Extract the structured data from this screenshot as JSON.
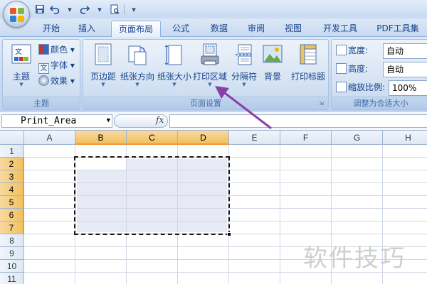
{
  "qat": {
    "icons": [
      "save-icon",
      "undo-icon",
      "redo-icon",
      "print-preview-icon",
      "customize-icon"
    ]
  },
  "tabs": [
    {
      "label": "开始",
      "active": false
    },
    {
      "label": "插入",
      "active": false
    },
    {
      "label": "页面布局",
      "active": true
    },
    {
      "label": "公式",
      "active": false
    },
    {
      "label": "数据",
      "active": false
    },
    {
      "label": "审阅",
      "active": false
    },
    {
      "label": "视图",
      "active": false
    },
    {
      "label": "开发工具",
      "active": false
    },
    {
      "label": "PDF工具集",
      "active": false
    }
  ],
  "ribbon": {
    "theme_group": {
      "label": "主题",
      "themes_button": "主题",
      "colors_button": "颜色",
      "fonts_button": "字体",
      "effects_button": "效果"
    },
    "page_setup_group": {
      "label": "页面设置",
      "margins": "页边距",
      "orientation": "纸张方向",
      "size": "纸张大小",
      "print_area": "打印区域",
      "breaks": "分隔符",
      "background": "背景",
      "print_titles": "打印标题"
    },
    "scale_group": {
      "label": "调整为合适大小",
      "width_label": "宽度:",
      "width_value": "自动",
      "height_label": "高度:",
      "height_value": "自动",
      "scale_label": "缩放比例:",
      "scale_value": "100%"
    }
  },
  "formula_bar": {
    "name_box": "Print_Area",
    "fx_label": "fx",
    "formula": ""
  },
  "grid": {
    "columns": [
      "A",
      "B",
      "C",
      "D",
      "E",
      "F",
      "G",
      "H"
    ],
    "selected_columns": [
      "B",
      "C",
      "D"
    ],
    "rows": [
      "1",
      "2",
      "3",
      "4",
      "5",
      "6",
      "7",
      "8",
      "9",
      "10",
      "11"
    ],
    "selected_rows": [
      "2",
      "3",
      "4",
      "5",
      "6",
      "7"
    ],
    "selected_range": "B2:D7"
  },
  "annotation": {
    "arrow_color": "#8b3fa8"
  },
  "watermark": "软件技巧"
}
